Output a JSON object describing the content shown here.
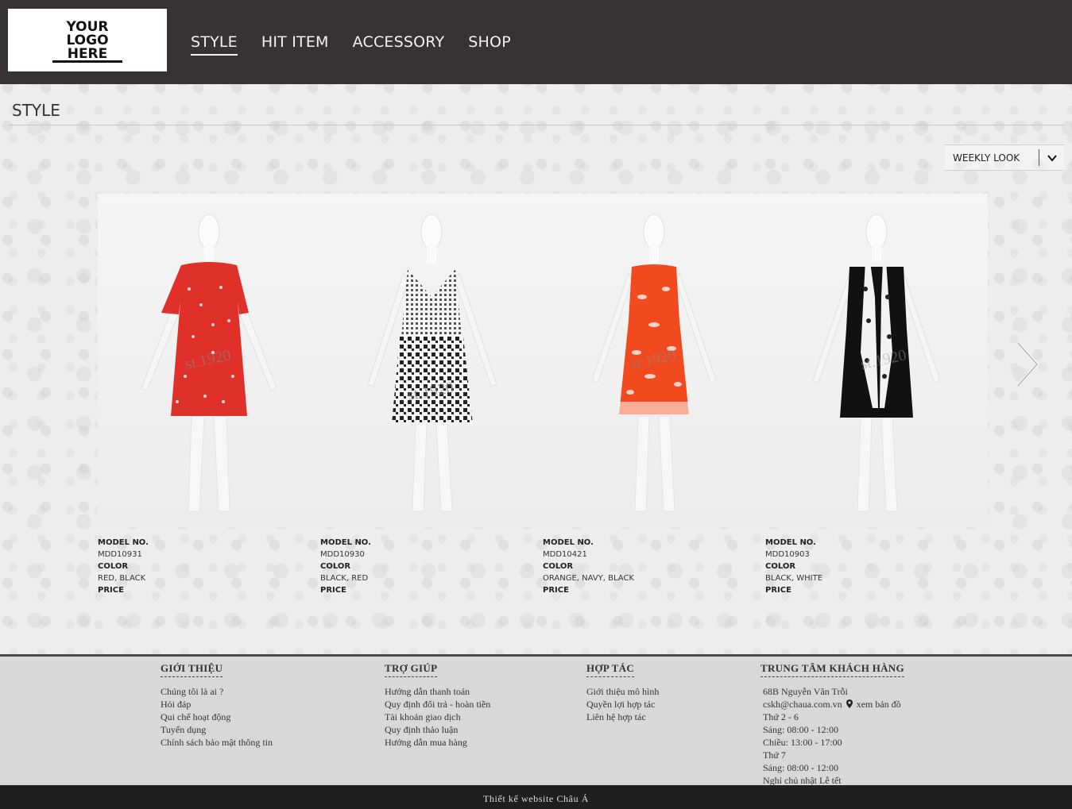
{
  "header": {
    "logo_text": "YOUR LOGO HERE",
    "nav": [
      {
        "label": "STYLE",
        "active": true
      },
      {
        "label": "HIT ITEM"
      },
      {
        "label": "ACCESSORY"
      },
      {
        "label": "SHOP"
      }
    ]
  },
  "page_title": "STYLE",
  "filter": {
    "selected": "WEEKLY LOOK",
    "icon": "chevron-down-icon"
  },
  "labels": {
    "model": "MODEL NO.",
    "color": "COLOR",
    "price": "PRICE"
  },
  "products": [
    {
      "model": "MDD10931",
      "color": "RED, BLACK",
      "watermark": "st.1920"
    },
    {
      "model": "MDD10930",
      "color": "BLACK, RED",
      "watermark": "st.1920"
    },
    {
      "model": "MDD10421",
      "color": "ORANGE, NAVY, BLACK",
      "watermark": "st.1920"
    },
    {
      "model": "MDD10903",
      "color": "BLACK, WHITE",
      "watermark": "st.1920"
    }
  ],
  "footer": {
    "about": {
      "heading": "GIỚI THIỆU",
      "links": [
        "Chúng tôi là ai ?",
        "Hỏi đáp",
        "Qui chế hoạt động",
        "Tuyển dụng",
        "Chính sách bảo mật thông tin"
      ]
    },
    "help": {
      "heading": "TRỢ GIÚP",
      "links": [
        "Hướng dẫn thanh toán",
        "Quy định đổi trả - hoàn tiền",
        "Tài khoản giao dịch",
        "Quy định thảo luận",
        "Hướng dẫn mua hàng"
      ]
    },
    "partner": {
      "heading": "HỢP TÁC",
      "links": [
        "Giới thiệu mô hình",
        "Quyền lợi hợp tác",
        "Liên hệ hợp tác"
      ]
    },
    "support": {
      "heading": "TRUNG TÂM KHÁCH HÀNG",
      "address": "68B Nguyễn Văn Trỗi",
      "email": "cskh@chaua.com.vn",
      "map_link": "xem bản đồ",
      "lines": [
        "Thứ 2 - 6",
        "Sáng: 08:00 - 12:00",
        "Chiều: 13:00 - 17:00",
        "Thứ 7",
        "Sáng: 08:00 - 12:00",
        "Nghỉ chủ nhật Lễ tết"
      ]
    }
  },
  "credit": "Thiết kế website Châu Á",
  "colors": {
    "header_bg": "#373334",
    "footer_bg": "#d8d8d8",
    "bottom_bar": "#1f1f1f",
    "dress_red": "#e0302a",
    "dress_orange": "#f04a1e"
  }
}
